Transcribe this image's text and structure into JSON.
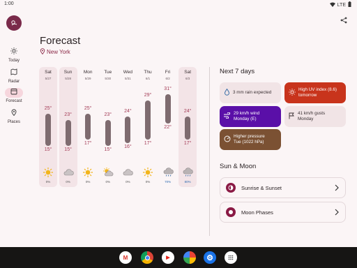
{
  "status_bar": {
    "time": "1:00",
    "network": "LTE"
  },
  "nav": {
    "items": [
      {
        "label": "Today"
      },
      {
        "label": "Radar"
      },
      {
        "label": "Forecast"
      },
      {
        "label": "Places"
      }
    ],
    "active": "Forecast"
  },
  "header": {
    "title": "Forecast",
    "location": "New York"
  },
  "forecast": [
    {
      "day": "Sat",
      "date": "5/27",
      "high": "25°",
      "low": "15°",
      "icon": "sun-icon",
      "precip": "0%",
      "highlight": true
    },
    {
      "day": "Sun",
      "date": "5/28",
      "high": "23°",
      "low": "15°",
      "icon": "cloud-icon",
      "precip": "0%",
      "highlight": true
    },
    {
      "day": "Mon",
      "date": "5/29",
      "high": "25°",
      "low": "17°",
      "icon": "sun-icon",
      "precip": "0%",
      "highlight": false
    },
    {
      "day": "Tue",
      "date": "5/30",
      "high": "23°",
      "low": "15°",
      "icon": "partly-cloudy-icon",
      "precip": "0%",
      "highlight": false
    },
    {
      "day": "Wed",
      "date": "5/31",
      "high": "24°",
      "low": "16°",
      "icon": "cloud-icon",
      "precip": "0%",
      "highlight": false
    },
    {
      "day": "Thu",
      "date": "6/1",
      "high": "29°",
      "low": "17°",
      "icon": "sun-icon",
      "precip": "0%",
      "highlight": false
    },
    {
      "day": "Fri",
      "date": "6/2",
      "high": "31°",
      "low": "22°",
      "icon": "rain-cloud-icon",
      "precip": "70%",
      "highlight": false
    },
    {
      "day": "Sat",
      "date": "6/3",
      "high": "24°",
      "low": "17°",
      "icon": "rain-cloud-icon",
      "precip": "80%",
      "highlight": true
    }
  ],
  "next7": {
    "title": "Next 7 days",
    "chips": [
      {
        "text1": "3 mm rain expected",
        "text2": "",
        "icon": "raindrop-icon",
        "color": "#f1e4e6"
      },
      {
        "text1": "High UV index (8.6)",
        "text2": "tomorrow",
        "icon": "uv-sun-icon",
        "color": "#c8341c"
      },
      {
        "text1": "29 km/h wind",
        "text2": "Monday (E)",
        "icon": "wind-icon",
        "color": "#5a0fa8"
      },
      {
        "text1": "41 km/h gusts",
        "text2": "Monday",
        "icon": "gust-flag-icon",
        "color": "#f1e4e6"
      },
      {
        "text1": "Higher pressure",
        "text2": "Tue (1022 hPa)",
        "icon": "gauge-icon",
        "color": "#7b5133"
      }
    ]
  },
  "sun_moon": {
    "title": "Sun & Moon",
    "cards": [
      {
        "label": "Sunrise & Sunset"
      },
      {
        "label": "Moon Phases"
      }
    ]
  },
  "taskbar": {
    "apps": [
      {
        "name": "gmail-icon",
        "glyph": "M"
      },
      {
        "name": "chrome-icon",
        "glyph": ""
      },
      {
        "name": "youtube-icon",
        "glyph": "▶"
      },
      {
        "name": "photos-icon",
        "glyph": ""
      },
      {
        "name": "settings-icon",
        "glyph": "⚙"
      },
      {
        "name": "app-drawer-icon",
        "glyph": ""
      }
    ]
  },
  "colors": {
    "accent": "#8a1a45",
    "bar": "#7e6b6f",
    "temp": "#a33a55"
  }
}
